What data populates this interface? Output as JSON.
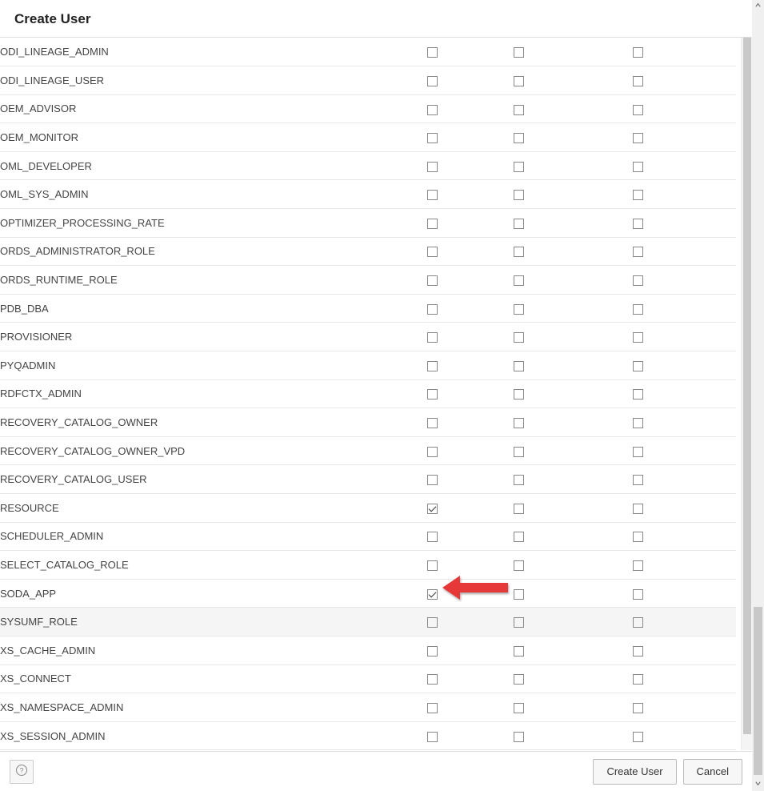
{
  "dialog": {
    "title": "Create User"
  },
  "roles": [
    {
      "name": "ODI_LINEAGE_ADMIN",
      "col1": false,
      "col2": false,
      "col3": false,
      "hovered": false
    },
    {
      "name": "ODI_LINEAGE_USER",
      "col1": false,
      "col2": false,
      "col3": false,
      "hovered": false
    },
    {
      "name": "OEM_ADVISOR",
      "col1": false,
      "col2": false,
      "col3": false,
      "hovered": false
    },
    {
      "name": "OEM_MONITOR",
      "col1": false,
      "col2": false,
      "col3": false,
      "hovered": false
    },
    {
      "name": "OML_DEVELOPER",
      "col1": false,
      "col2": false,
      "col3": false,
      "hovered": false
    },
    {
      "name": "OML_SYS_ADMIN",
      "col1": false,
      "col2": false,
      "col3": false,
      "hovered": false
    },
    {
      "name": "OPTIMIZER_PROCESSING_RATE",
      "col1": false,
      "col2": false,
      "col3": false,
      "hovered": false
    },
    {
      "name": "ORDS_ADMINISTRATOR_ROLE",
      "col1": false,
      "col2": false,
      "col3": false,
      "hovered": false
    },
    {
      "name": "ORDS_RUNTIME_ROLE",
      "col1": false,
      "col2": false,
      "col3": false,
      "hovered": false
    },
    {
      "name": "PDB_DBA",
      "col1": false,
      "col2": false,
      "col3": false,
      "hovered": false
    },
    {
      "name": "PROVISIONER",
      "col1": false,
      "col2": false,
      "col3": false,
      "hovered": false
    },
    {
      "name": "PYQADMIN",
      "col1": false,
      "col2": false,
      "col3": false,
      "hovered": false
    },
    {
      "name": "RDFCTX_ADMIN",
      "col1": false,
      "col2": false,
      "col3": false,
      "hovered": false
    },
    {
      "name": "RECOVERY_CATALOG_OWNER",
      "col1": false,
      "col2": false,
      "col3": false,
      "hovered": false
    },
    {
      "name": "RECOVERY_CATALOG_OWNER_VPD",
      "col1": false,
      "col2": false,
      "col3": false,
      "hovered": false
    },
    {
      "name": "RECOVERY_CATALOG_USER",
      "col1": false,
      "col2": false,
      "col3": false,
      "hovered": false
    },
    {
      "name": "RESOURCE",
      "col1": true,
      "col2": false,
      "col3": false,
      "hovered": false
    },
    {
      "name": "SCHEDULER_ADMIN",
      "col1": false,
      "col2": false,
      "col3": false,
      "hovered": false
    },
    {
      "name": "SELECT_CATALOG_ROLE",
      "col1": false,
      "col2": false,
      "col3": false,
      "hovered": false
    },
    {
      "name": "SODA_APP",
      "col1": true,
      "col2": false,
      "col3": false,
      "hovered": false
    },
    {
      "name": "SYSUMF_ROLE",
      "col1": false,
      "col2": false,
      "col3": false,
      "hovered": true
    },
    {
      "name": "XS_CACHE_ADMIN",
      "col1": false,
      "col2": false,
      "col3": false,
      "hovered": false
    },
    {
      "name": "XS_CONNECT",
      "col1": false,
      "col2": false,
      "col3": false,
      "hovered": false
    },
    {
      "name": "XS_NAMESPACE_ADMIN",
      "col1": false,
      "col2": false,
      "col3": false,
      "hovered": false
    },
    {
      "name": "XS_SESSION_ADMIN",
      "col1": false,
      "col2": false,
      "col3": false,
      "hovered": false
    }
  ],
  "footer": {
    "help_label": "?",
    "primary_label": "Create User",
    "cancel_label": "Cancel"
  },
  "annotation": {
    "arrow_color": "#e63939"
  }
}
